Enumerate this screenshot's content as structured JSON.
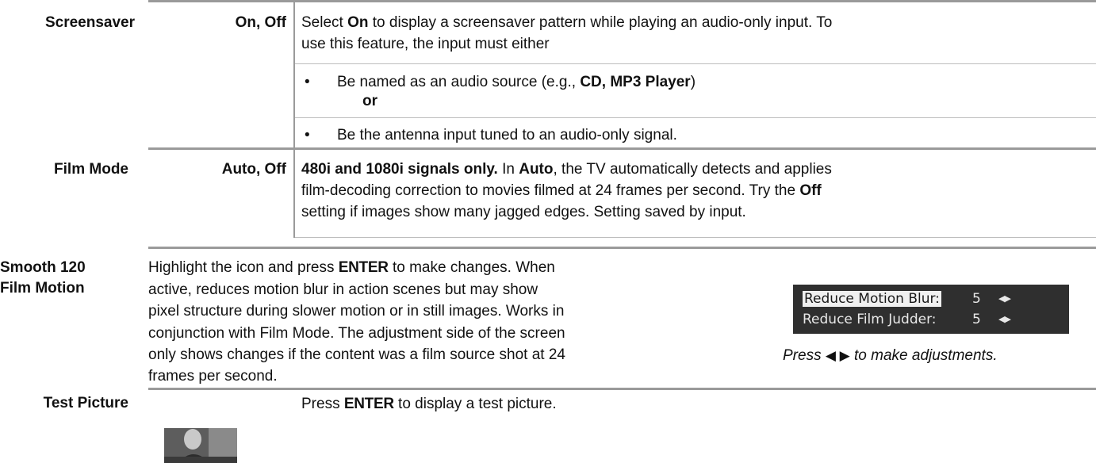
{
  "screensaver": {
    "label": "Screensaver",
    "values": "On, Off",
    "line1_a": "Select ",
    "line1_b": "On",
    "line1_c": " to display a screensaver pattern while playing an audio-only input.  To",
    "line2": "use this feature, the input must either",
    "bullet1_a": "Be named as an audio source (e.g., ",
    "bullet1_b": "CD, MP3 Player",
    "bullet1_c": ")",
    "or_text": "or",
    "bullet2": "Be the antenna input tuned to an audio-only signal."
  },
  "film_mode": {
    "label": "Film Mode",
    "values": "Auto, Off",
    "l1_a": "480i and 1080i signals only.",
    "l1_b": "  In ",
    "l1_c": "Auto",
    "l1_d": ", the TV automatically detects and applies",
    "l2_a": "film-decoding correction to movies filmed at 24 frames per second.  Try the ",
    "l2_b": "Off",
    "l3": "setting if images show many jagged edges.  Setting saved by input."
  },
  "smooth": {
    "label_line1": "Smooth 120",
    "label_line2": "Film Motion",
    "l1_a": "Highlight the icon and press ",
    "l1_b": "ENTER",
    "l1_c": " to make changes.  When",
    "l2": "active, reduces motion blur in action scenes but may show",
    "l3": "pixel structure during slower motion or in still images.  Works in",
    "l4": "conjunction with Film Mode.  The adjustment side of the screen",
    "l5": "only shows changes if the content was a film source shot at 24",
    "l6": "frames per second.",
    "osd": {
      "row1_label": "Reduce Motion Blur:",
      "row1_value": "5",
      "row2_label": "Reduce Film Judder:",
      "row2_value": "5",
      "arrows": "◀▶"
    },
    "caption_a": "Press ",
    "caption_arrows": "◀ ▶",
    "caption_b": " to make adjustments."
  },
  "test_picture": {
    "label": "Test Picture",
    "text_a": "Press ",
    "text_b": "ENTER",
    "text_c": " to display a test picture."
  }
}
